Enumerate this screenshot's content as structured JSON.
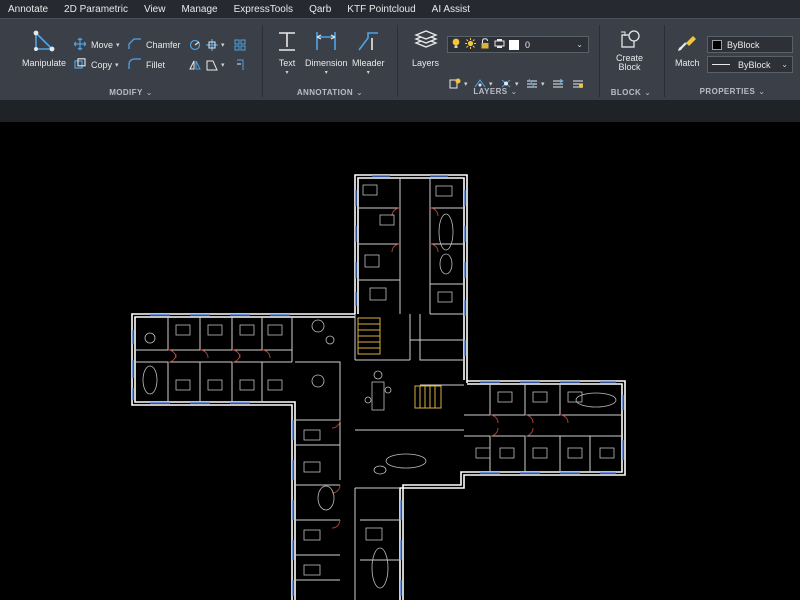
{
  "menu": {
    "items": [
      "Annotate",
      "2D Parametric",
      "View",
      "Manage",
      "ExpressTools",
      "Qarb",
      "KTF Pointcloud",
      "AI Assist"
    ]
  },
  "ribbon": {
    "modify": {
      "label": "MODIFY",
      "manipulate": "Manipulate",
      "move": "Move",
      "copy": "Copy",
      "chamfer": "Chamfer",
      "fillet": "Fillet"
    },
    "annotation": {
      "label": "ANNOTATION",
      "text": "Text",
      "dimension": "Dimension",
      "mleader": "Mleader"
    },
    "layers": {
      "label": "LAYERS",
      "layers_button": "Layers",
      "current_layer": "0"
    },
    "block": {
      "label": "BLOCK",
      "create_line1": "Create",
      "create_line2": "Block"
    },
    "properties": {
      "label": "PROPERTIES",
      "match": "Match",
      "color": "ByBlock",
      "linetype": "ByBlock"
    }
  },
  "colors": {
    "menubar_bg": "#262a30",
    "ribbon_bg": "#3b4048",
    "canvas_bg": "#000000",
    "icon_blue": "#4ea3e6",
    "wall_white": "#ffffff",
    "stair_yellow": "#d9b13b",
    "door_red": "#b04a3a",
    "window_blue": "#3a6fd0"
  },
  "icons": [
    "manipulate-icon",
    "move-icon",
    "copy-icon",
    "chamfer-icon",
    "fillet-icon",
    "text-icon",
    "dimension-icon",
    "mleader-icon",
    "layers-icon",
    "lightbulb-icon",
    "sun-icon",
    "lock-icon",
    "create-block-icon",
    "match-brush-icon"
  ]
}
